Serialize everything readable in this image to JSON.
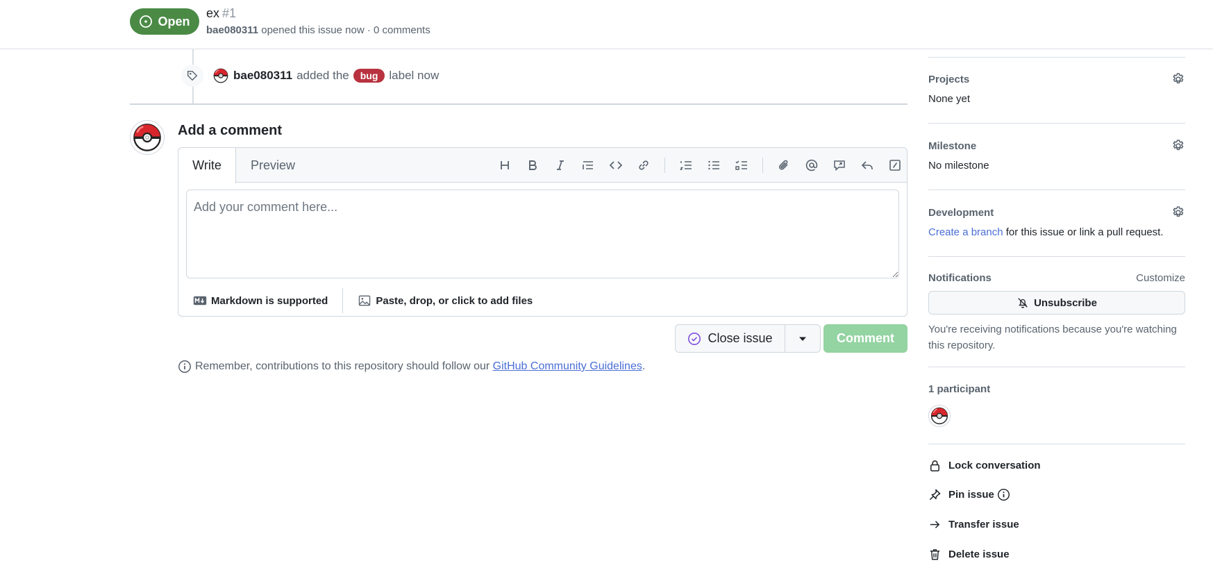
{
  "header": {
    "state_label": "Open",
    "title": "ex",
    "number": "#1",
    "author": "bae080311",
    "meta_text": " opened this issue now · 0 comments"
  },
  "timeline": {
    "actor": "bae080311",
    "pre_label": "added the",
    "label": "bug",
    "post_label": "label now"
  },
  "composer": {
    "heading": "Add a comment",
    "tab_write": "Write",
    "tab_preview": "Preview",
    "placeholder": "Add your comment here...",
    "toolbar": [
      "heading-icon",
      "bold-icon",
      "italic-icon",
      "quote-icon",
      "code-icon",
      "link-icon",
      "ordered-list-icon",
      "unordered-list-icon",
      "task-list-icon",
      "attach-icon",
      "mention-icon",
      "reference-icon",
      "reply-icon",
      "slash-command-icon"
    ],
    "markdown_note": "Markdown is supported",
    "files_note": "Paste, drop, or click to add files",
    "close_label": "Close issue",
    "comment_label": "Comment",
    "guidelines_pre": "Remember, contributions to this repository should follow our",
    "guidelines_link": "GitHub Community Guidelines",
    "guidelines_post": "."
  },
  "sidebar": {
    "projects": {
      "heading": "Projects",
      "value": "None yet"
    },
    "milestone": {
      "heading": "Milestone",
      "value": "No milestone"
    },
    "development": {
      "heading": "Development",
      "link": "Create a branch",
      "rest": " for this issue or link a pull request."
    },
    "notifications": {
      "heading": "Notifications",
      "customize": "Customize",
      "button": "Unsubscribe",
      "note": "You're receiving notifications because you're watching this repository."
    },
    "participants": {
      "heading": "1 participant"
    },
    "actions": {
      "lock": "Lock conversation",
      "pin": "Pin issue",
      "transfer": "Transfer issue",
      "delete": "Delete issue"
    }
  },
  "colors": {
    "open_green": "#4a8a45",
    "bug_red": "#b8333f",
    "link_blue": "#4a6ed6",
    "comment_disabled": "#94d3a2"
  }
}
